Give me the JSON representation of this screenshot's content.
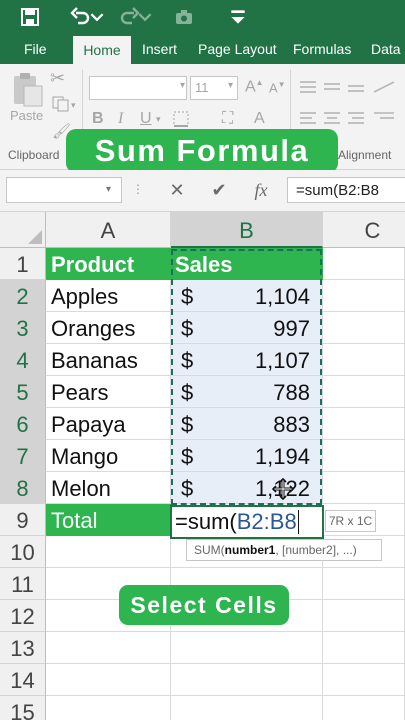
{
  "title_bar": {
    "icons": [
      "save-icon",
      "undo-icon",
      "undo-dropdown-icon",
      "redo-icon",
      "camera-icon",
      "customize-toolbar-icon"
    ]
  },
  "tabs": [
    {
      "label": "File"
    },
    {
      "label": "Home",
      "active": true
    },
    {
      "label": "Insert"
    },
    {
      "label": "Page Layout"
    },
    {
      "label": "Formulas"
    },
    {
      "label": "Data"
    }
  ],
  "ribbon": {
    "paste_label": "Paste",
    "clipboard_label": "Clipboard",
    "font_size": "11",
    "alignment_label": "Alignment",
    "bold": "B",
    "italic": "I",
    "underline": "U"
  },
  "overlay": {
    "title": "Sum Formula",
    "subtitle": "Select Cells"
  },
  "formula_bar": {
    "name_box": "",
    "cancel": "✕",
    "enter": "✔",
    "fx": "fx",
    "value": "=sum(B2:B8"
  },
  "sheet": {
    "columns": [
      "A",
      "B",
      "C"
    ],
    "rows": [
      "1",
      "2",
      "3",
      "4",
      "5",
      "6",
      "7",
      "8",
      "9",
      "10",
      "11",
      "12",
      "13",
      "14",
      "15"
    ],
    "header": {
      "a": "Product",
      "b": "Sales"
    },
    "data": [
      {
        "product": "Apples",
        "currency": "$",
        "amount": "1,104"
      },
      {
        "product": "Oranges",
        "currency": "$",
        "amount": "997"
      },
      {
        "product": "Bananas",
        "currency": "$",
        "amount": "1,107"
      },
      {
        "product": "Pears",
        "currency": "$",
        "amount": "788"
      },
      {
        "product": "Papaya",
        "currency": "$",
        "amount": "883"
      },
      {
        "product": "Mango",
        "currency": "$",
        "amount": "1,194"
      },
      {
        "product": "Melon",
        "currency": "$",
        "amount": "1,122"
      }
    ],
    "total_label": "Total",
    "active_cell": {
      "prefix": "=sum(",
      "ref": "B2:B8"
    },
    "size_tip": "7R x 1C",
    "function_tip": {
      "name": "SUM(",
      "arg1": "number1",
      "rest": ", [number2], ...)"
    }
  },
  "colors": {
    "excel_green": "#217346",
    "highlight_green": "#2fb54f",
    "reference_blue": "#2b579a"
  }
}
